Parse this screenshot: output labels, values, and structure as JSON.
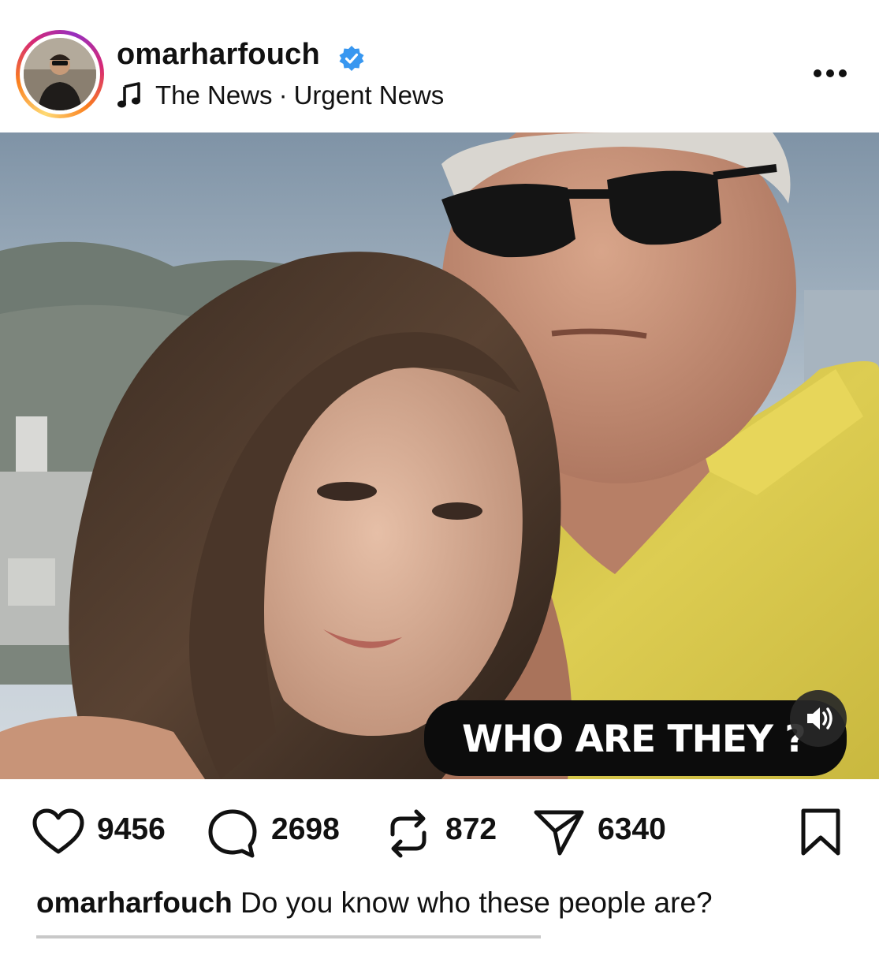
{
  "post": {
    "username": "omarharfouch",
    "verified": true,
    "audio": {
      "artist": "The News",
      "separator": "·",
      "title": "Urgent News"
    },
    "more_icon": "more-horizontal-icon",
    "media": {
      "overlay_text": "WHO ARE THEY ?",
      "sound_icon": "speaker-icon"
    },
    "stats": {
      "likes": "9456",
      "comments": "2698",
      "reposts": "872",
      "shares": "6340"
    },
    "caption": {
      "username": "omarharfouch",
      "text": " Do you know who these people are?"
    }
  },
  "colors": {
    "verified_badge": "#3897f0",
    "text_primary": "#111111",
    "ring_gradient": [
      "#feda75",
      "#fa7e1e",
      "#d62976",
      "#962fbf"
    ],
    "caption_pill": "#0c0c0c",
    "shirt": "#d9c84a"
  }
}
